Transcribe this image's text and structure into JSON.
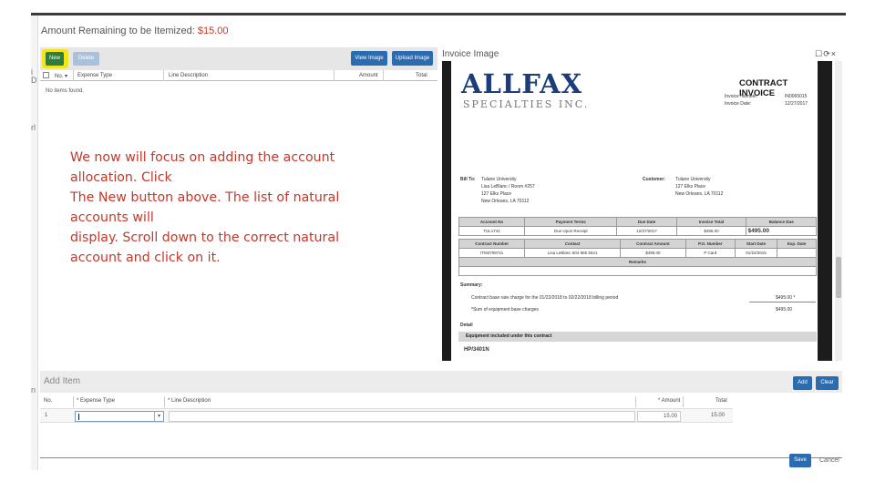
{
  "header": {
    "amount_label": "Amount Remaining to be Itemized:",
    "amount_value": "$15.00"
  },
  "toolbar": {
    "new_label": "New",
    "delete_label": "Delete",
    "view_image_label": "View Image",
    "upload_image_label": "Upload Image"
  },
  "grid": {
    "columns": {
      "no": "No. ▾",
      "expense_type": "Expense Type",
      "line_description": "Line Description",
      "amount": "Amount",
      "total": "Total"
    },
    "empty_text": "No items found."
  },
  "left_strip": [
    "i",
    "D",
    "rl",
    "n"
  ],
  "callout": {
    "text": "We now will focus on adding the account allocation.  Click\nThe New button above.  The list of natural accounts will\ndisplay.  Scroll down to the correct natural account and click on it."
  },
  "invoice_panel": {
    "title": "Invoice Image",
    "controls": "☐⟳×",
    "doc": {
      "company": "ALLFAX",
      "company_sub": "SPECIALTIES INC.",
      "title": "CONTRACT INVOICE",
      "meta": "Invoice Number:\nInvoice Date:",
      "meta_values": "IN0065015\n12/27/2017",
      "bill_to_label": "Bill To:",
      "bill_to": "Tulane University\nLisa LeBlanc  / Room #257\n127 Elks Place\nNew Orleans, LA  70112",
      "customer_label": "Customer:",
      "customer": "Tulane University\n127 Elks Place\nNew Orleans, LA  70112",
      "table1_head": [
        "Account No",
        "Payment Terms",
        "Due Date",
        "Invoice Total",
        "Balance Due"
      ],
      "table1_row": [
        "TUL1741",
        "Due Upon Receipt",
        "12/27/2017",
        "$495.00",
        "$495.00"
      ],
      "table2_head": [
        "Contract Number",
        "Contact",
        "Contract Amount",
        "P.O. Number",
        "Start Date",
        "Exp. Date"
      ],
      "table2_row": [
        "ITM3708741",
        "Lisa LeBlanc 504 865 5521",
        "$495.00",
        "P Card",
        "01/22/2015",
        ""
      ],
      "remarks_label": "Remarks",
      "summary_label": "Summary:",
      "summary_line1": "Contract base rate charge for the 01/22/2018 to 02/22/2018 billing period",
      "summary_val1": "$495.00 *",
      "summary_line2": "*Sum of equipment base charges",
      "summary_val2": "$495.00",
      "detail_label": "Detail",
      "equip_label": "Equipment included under this contract",
      "model": "HP/3401N"
    }
  },
  "add_item": {
    "title": "Add Item",
    "add_label": "Add",
    "clear_label": "Clear",
    "columns": {
      "no": "No.",
      "expense_type": "* Expense Type",
      "line_description": "* Line Description",
      "amount": "* Amount",
      "total": "Total"
    },
    "row": {
      "no": "1",
      "amount": "15.00",
      "total": "15.00"
    }
  },
  "footer": {
    "save_label": "Save",
    "cancel_label": "Cancel"
  }
}
